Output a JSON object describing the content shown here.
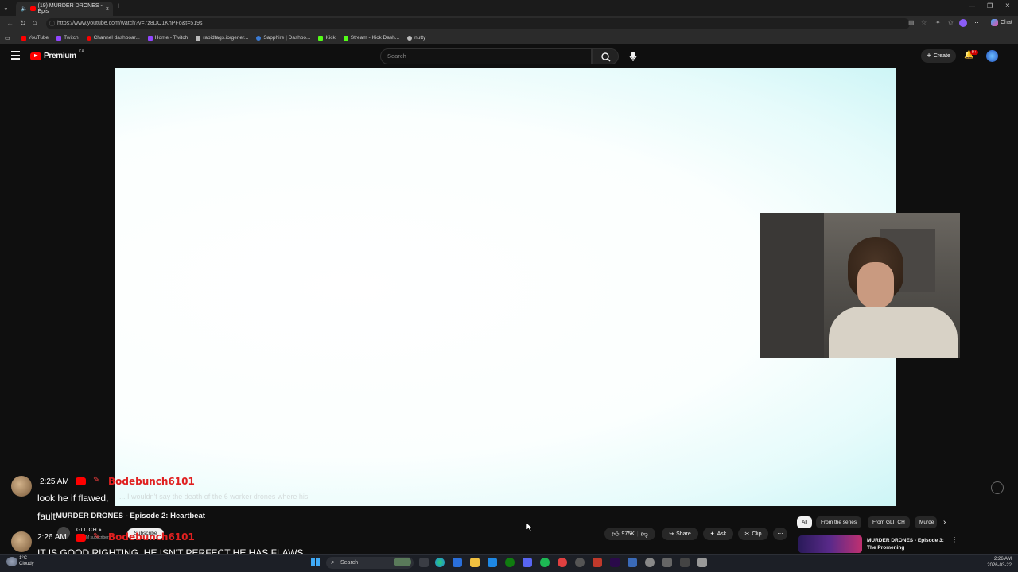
{
  "browser": {
    "tab_title": "(19) MURDER DRONES - Epis",
    "url": "https://www.youtube.com/watch?v=7z8DO1KhPFo&t=519s",
    "chat_button": "Chat",
    "bookmarks": [
      {
        "label": "YouTube",
        "color": "#ff0000"
      },
      {
        "label": "Twitch",
        "color": "#9146ff"
      },
      {
        "label": "Channel dashboar...",
        "color": "#ff0000"
      },
      {
        "label": "Home - Twitch",
        "color": "#9146ff"
      },
      {
        "label": "rapidtags.io/gener...",
        "color": "#bbbbbb"
      },
      {
        "label": "Sapphire | Dashbo...",
        "color": "#3a7bd5"
      },
      {
        "label": "Kick",
        "color": "#53fc18"
      },
      {
        "label": "Stream - Kick Dash...",
        "color": "#53fc18"
      },
      {
        "label": "nutty",
        "color": "#bbbbbb"
      }
    ]
  },
  "youtube": {
    "logo_text": "Premium",
    "logo_region": "CA",
    "search_placeholder": "Search",
    "create_label": "Create",
    "notification_count": "9+",
    "video_subtitle": "... I wouldn't say the death of the 6 worker drones where his",
    "video_title": "MURDER DRONES - Episode 2: Heartbeat",
    "channel_name": "GLITCH",
    "channel_subs": "M subscribers",
    "subscribe_label": "Subscribe",
    "like_count": "975K",
    "share_label": "Share",
    "ask_label": "Ask",
    "clip_label": "Clip",
    "chips": [
      "All",
      "From the series",
      "From GLITCH",
      "Murde"
    ],
    "recommendation": {
      "title_line1": "MURDER DRONES - Episode 3:",
      "title_line2": "The Promening"
    }
  },
  "chat": [
    {
      "time": "2:25 AM",
      "username": "Bodebunch6101",
      "message_line1": "look he if flawed,",
      "message_line2": "fault"
    },
    {
      "time": "2:26 AM",
      "username": "Bodebunch6101",
      "message_line1": "IT IS GOOD RIGHTING, HE ISN'T PERFECT HE HAS FLAWS"
    }
  ],
  "taskbar": {
    "weather_temp": "1°C",
    "weather_desc": "Cloudy",
    "search_label": "Search",
    "time": "2:26 AM",
    "date": "2026-03-22"
  }
}
